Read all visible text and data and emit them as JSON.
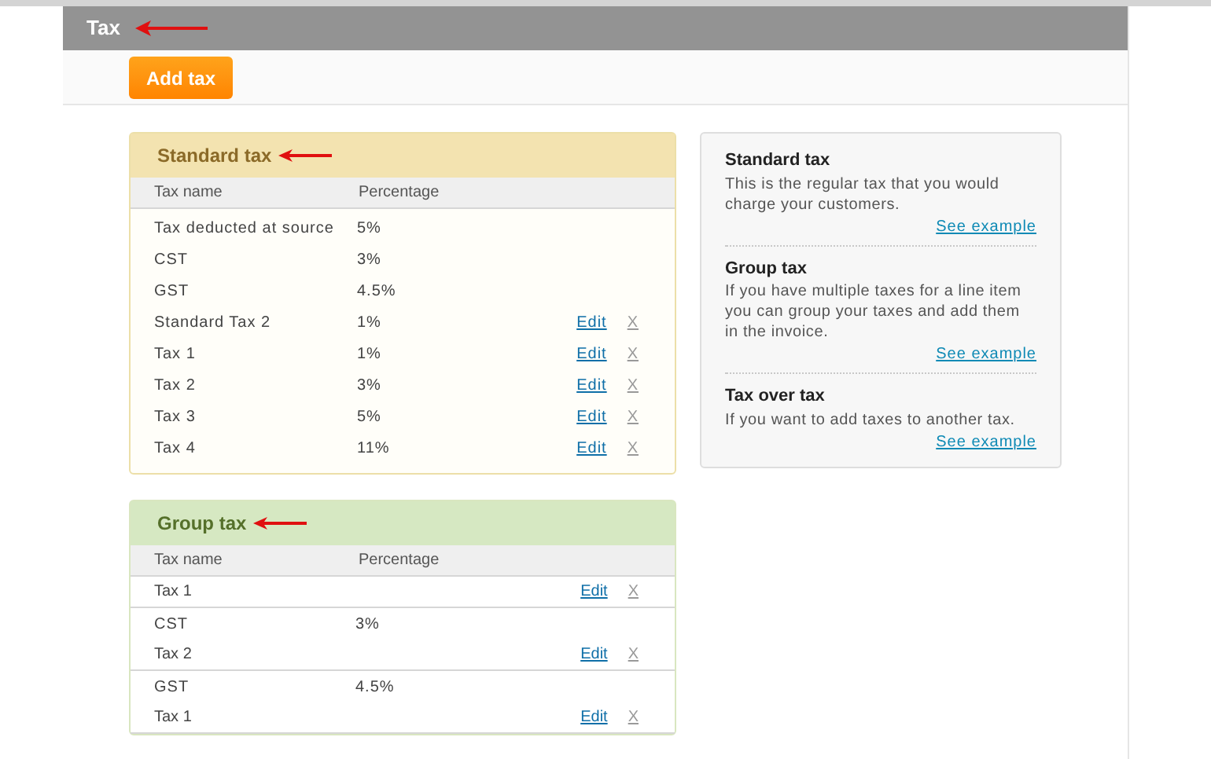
{
  "header": {
    "title": "Tax"
  },
  "toolbar": {
    "add_button": "Add tax"
  },
  "standard_tax": {
    "title": "Standard tax",
    "columns": [
      "Tax name",
      "Percentage"
    ],
    "rows": [
      {
        "name": "Tax deducted at source",
        "percentage": "5%"
      },
      {
        "name": "CST",
        "percentage": "3%"
      },
      {
        "name": "GST",
        "percentage": "4.5%"
      },
      {
        "name": "Standard Tax 2",
        "percentage": "1%",
        "edit": "Edit",
        "delete": "X"
      },
      {
        "name": "Tax 1",
        "percentage": "1%",
        "edit": "Edit",
        "delete": "X"
      },
      {
        "name": "Tax 2",
        "percentage": "3%",
        "edit": "Edit",
        "delete": "X"
      },
      {
        "name": "Tax 3",
        "percentage": "5%",
        "edit": "Edit",
        "delete": "X"
      },
      {
        "name": "Tax 4",
        "percentage": "11%",
        "edit": "Edit",
        "delete": "X"
      }
    ]
  },
  "group_tax": {
    "title": "Group tax",
    "columns": [
      "Tax name",
      "Percentage"
    ],
    "rows": [
      {
        "kind": "group",
        "name": "Tax 1",
        "edit": "Edit",
        "delete": "X"
      },
      {
        "kind": "member",
        "name": "CST",
        "percentage": "3%"
      },
      {
        "kind": "group",
        "name": "Tax 2",
        "edit": "Edit",
        "delete": "X"
      },
      {
        "kind": "member",
        "name": "GST",
        "percentage": "4.5%"
      },
      {
        "kind": "group",
        "name": "Tax 1",
        "edit": "Edit",
        "delete": "X"
      }
    ]
  },
  "help": [
    {
      "title": "Standard tax",
      "text": "This is the regular tax that you would charge your customers.",
      "link": "See example"
    },
    {
      "title": "Group tax",
      "text": "If you have multiple taxes for a line item you can group your taxes and add them in the invoice.",
      "link": "See example"
    },
    {
      "title": "Tax over tax",
      "text": "If you want to add taxes to another tax.",
      "link": "See example"
    }
  ]
}
